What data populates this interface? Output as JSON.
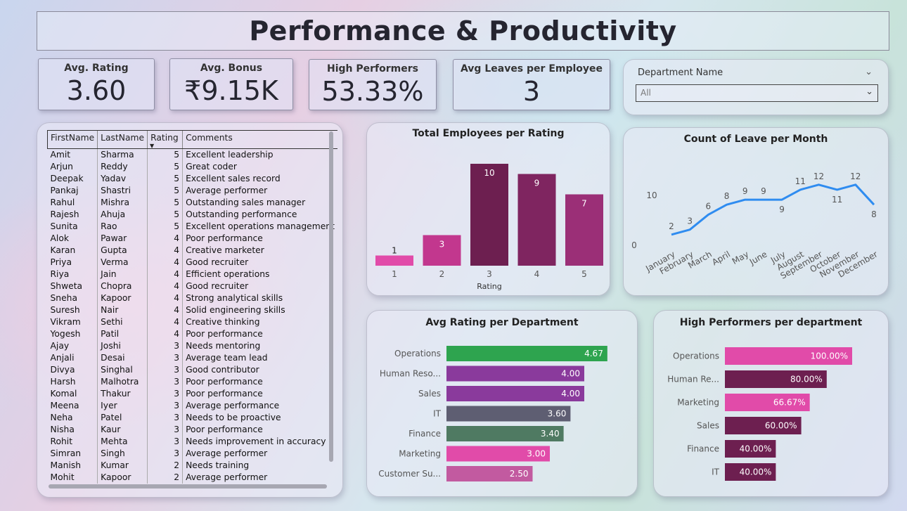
{
  "title": "Performance & Productivity",
  "kpis": {
    "avg_rating": {
      "label": "Avg. Rating",
      "value": "3.60"
    },
    "avg_bonus": {
      "label": "Avg. Bonus",
      "value": "₹9.15K"
    },
    "high_performers": {
      "label": "High Performers",
      "value": "53.33%"
    },
    "avg_leaves": {
      "label": "Avg Leaves per Employee",
      "value": "3"
    }
  },
  "slicer": {
    "title": "Department Name",
    "value": "All"
  },
  "table": {
    "columns": [
      "FirstName",
      "LastName",
      "Rating",
      "Comments"
    ],
    "rows": [
      [
        "Amit",
        "Sharma",
        "5",
        "Excellent leadership"
      ],
      [
        "Arjun",
        "Reddy",
        "5",
        "Great coder"
      ],
      [
        "Deepak",
        "Yadav",
        "5",
        "Excellent sales record"
      ],
      [
        "Pankaj",
        "Shastri",
        "5",
        "Average performer"
      ],
      [
        "Rahul",
        "Mishra",
        "5",
        "Outstanding sales manager"
      ],
      [
        "Rajesh",
        "Ahuja",
        "5",
        "Outstanding performance"
      ],
      [
        "Sunita",
        "Rao",
        "5",
        "Excellent operations management"
      ],
      [
        "Alok",
        "Pawar",
        "4",
        "Poor performance"
      ],
      [
        "Karan",
        "Gupta",
        "4",
        "Creative marketer"
      ],
      [
        "Priya",
        "Verma",
        "4",
        "Good recruiter"
      ],
      [
        "Riya",
        "Jain",
        "4",
        "Efficient operations"
      ],
      [
        "Shweta",
        "Chopra",
        "4",
        "Good recruiter"
      ],
      [
        "Sneha",
        "Kapoor",
        "4",
        "Strong analytical skills"
      ],
      [
        "Suresh",
        "Nair",
        "4",
        "Solid engineering skills"
      ],
      [
        "Vikram",
        "Sethi",
        "4",
        "Creative thinking"
      ],
      [
        "Yogesh",
        "Patil",
        "4",
        "Poor performance"
      ],
      [
        "Ajay",
        "Joshi",
        "3",
        "Needs mentoring"
      ],
      [
        "Anjali",
        "Desai",
        "3",
        "Average team lead"
      ],
      [
        "Divya",
        "Singhal",
        "3",
        "Good contributor"
      ],
      [
        "Harsh",
        "Malhotra",
        "3",
        "Poor performance"
      ],
      [
        "Komal",
        "Thakur",
        "3",
        "Poor performance"
      ],
      [
        "Meena",
        "Iyer",
        "3",
        "Average performance"
      ],
      [
        "Neha",
        "Patel",
        "3",
        "Needs to be proactive"
      ],
      [
        "Nisha",
        "Kaur",
        "3",
        "Poor performance"
      ],
      [
        "Rohit",
        "Mehta",
        "3",
        "Needs improvement in accuracy"
      ],
      [
        "Simran",
        "Singh",
        "3",
        "Average performer"
      ],
      [
        "Manish",
        "Kumar",
        "2",
        "Needs training"
      ],
      [
        "Mohit",
        "Kapoor",
        "2",
        "Average performer"
      ]
    ]
  },
  "chart_data": [
    {
      "id": "employees_per_rating",
      "type": "bar",
      "title": "Total Employees per Rating",
      "xlabel": "Rating",
      "categories": [
        "1",
        "2",
        "3",
        "4",
        "5"
      ],
      "values": [
        1,
        3,
        10,
        9,
        7
      ],
      "colors": [
        "#e14ba9",
        "#c2378e",
        "#6d1f50",
        "#7f2560",
        "#9b2f77"
      ]
    },
    {
      "id": "leave_per_month",
      "type": "line",
      "title": "Count of Leave per Month",
      "categories": [
        "January",
        "February",
        "March",
        "April",
        "May",
        "June",
        "July",
        "August",
        "September",
        "October",
        "November",
        "December"
      ],
      "values": [
        2,
        3,
        6,
        8,
        9,
        9,
        9,
        11,
        12,
        11,
        12,
        8
      ],
      "y_ticks": [
        "0",
        "10"
      ],
      "color": "#2f8cf0"
    },
    {
      "id": "avg_rating_per_department",
      "type": "bar",
      "orientation": "horizontal",
      "title": "Avg Rating per Department",
      "categories": [
        "Operations",
        "Human Reso...",
        "Sales",
        "IT",
        "Finance",
        "Marketing",
        "Customer Su..."
      ],
      "values": [
        4.67,
        4.0,
        4.0,
        3.6,
        3.4,
        3.0,
        2.5
      ],
      "labels": [
        "4.67",
        "4.00",
        "4.00",
        "3.60",
        "3.40",
        "3.00",
        "2.50"
      ],
      "colors": [
        "#2ea44f",
        "#8a3a9c",
        "#8a3a9c",
        "#5e5e72",
        "#4f7a62",
        "#e14ba9",
        "#c25aa0"
      ]
    },
    {
      "id": "high_performers_per_department",
      "type": "bar",
      "orientation": "horizontal",
      "title": "High Performers per department",
      "categories": [
        "Operations",
        "Human Re...",
        "Marketing",
        "Sales",
        "Finance",
        "IT"
      ],
      "values": [
        100.0,
        80.0,
        66.67,
        60.0,
        40.0,
        40.0
      ],
      "labels": [
        "100.00%",
        "80.00%",
        "66.67%",
        "60.00%",
        "40.00%",
        "40.00%"
      ],
      "colors": [
        "#e14ba9",
        "#6d1f50",
        "#e14ba9",
        "#6d1f50",
        "#6d1f50",
        "#6d1f50"
      ]
    }
  ]
}
